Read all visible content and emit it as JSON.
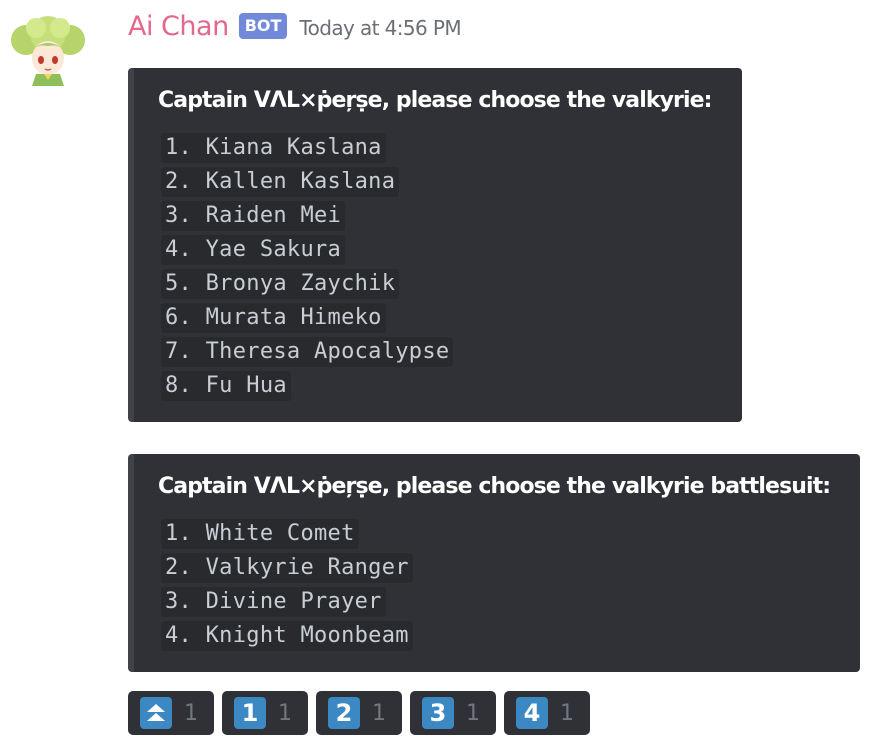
{
  "message": {
    "author": "Ai Chan",
    "bot_tag": "BOT",
    "timestamp": "Today at 4:56 PM"
  },
  "embeds": [
    {
      "title": "Captain VΛL×ṗeŗṣe, please choose the valkyrie:",
      "items": [
        "1. Kiana Kaslana",
        "2. Kallen Kaslana",
        "3. Raiden Mei",
        "4. Yae Sakura",
        "5. Bronya Zaychik",
        "6. Murata Himeko",
        "7. Theresa Apocalypse",
        "8. Fu Hua"
      ]
    },
    {
      "title": "Captain VΛL×ṗeŗṣe, please choose the valkyrie battlesuit:",
      "items": [
        "1. White Comet",
        "2. Valkyrie Ranger",
        "3. Divine Prayer",
        "4. Knight Moonbeam"
      ]
    }
  ],
  "reactions": [
    {
      "emoji": "⏫",
      "icon": "double-up-arrow-icon",
      "count": "1"
    },
    {
      "emoji": "1",
      "icon": "keycap-1-icon",
      "count": "1"
    },
    {
      "emoji": "2",
      "icon": "keycap-2-icon",
      "count": "1"
    },
    {
      "emoji": "3",
      "icon": "keycap-3-icon",
      "count": "1"
    },
    {
      "emoji": "4",
      "icon": "keycap-4-icon",
      "count": "1"
    }
  ],
  "colors": {
    "author": "#e3688a",
    "bot_tag": "#7289da",
    "embed_bg": "#2f3136",
    "keycap": "#3b88c3"
  }
}
